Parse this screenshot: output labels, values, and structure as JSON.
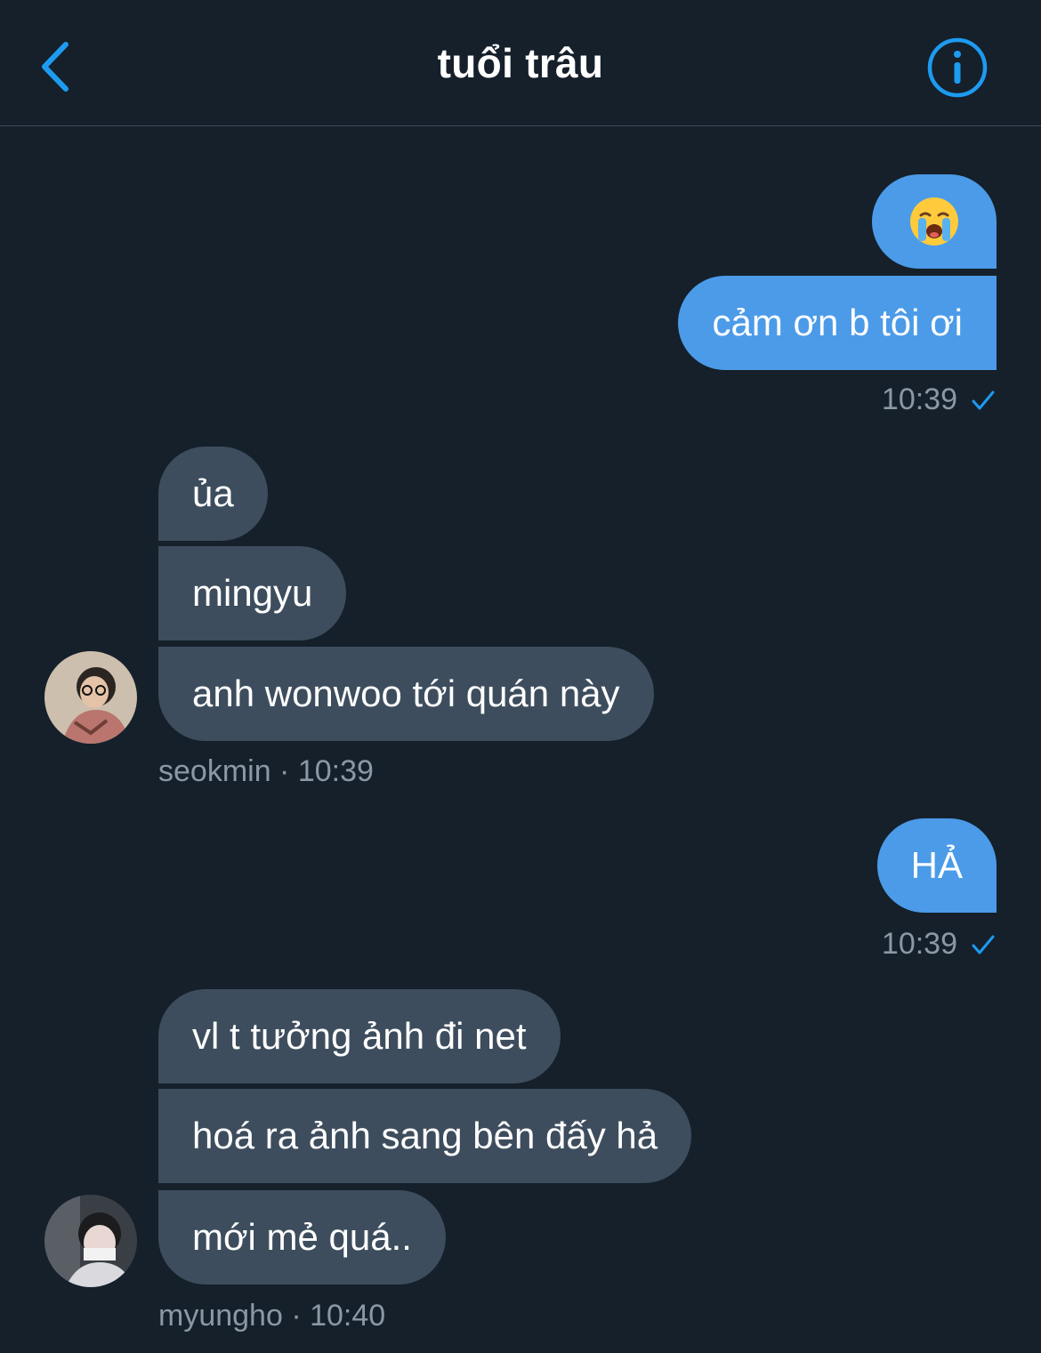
{
  "header": {
    "title": "tuổi trâu"
  },
  "messages": {
    "m1": "😭",
    "m2": "cảm ơn b tôi ơi",
    "m2_time": "10:39",
    "m3": "ủa",
    "m4": "mingyu",
    "m5": "anh wonwoo tới quán này",
    "m5_meta": "seokmin · 10:39",
    "m6": "HẢ",
    "m6_time": "10:39",
    "m7": "vl t tưởng ảnh đi net",
    "m8": "hoá ra ảnh sang bên đấy hả",
    "m9": "mới mẻ quá..",
    "m9_meta": "myungho · 10:40"
  },
  "colors": {
    "background": "#15202b",
    "outgoing_bubble": "#4b9be8",
    "incoming_bubble": "#3d4d5d",
    "accent": "#1d9bf0",
    "meta_text": "#8b98a5"
  }
}
